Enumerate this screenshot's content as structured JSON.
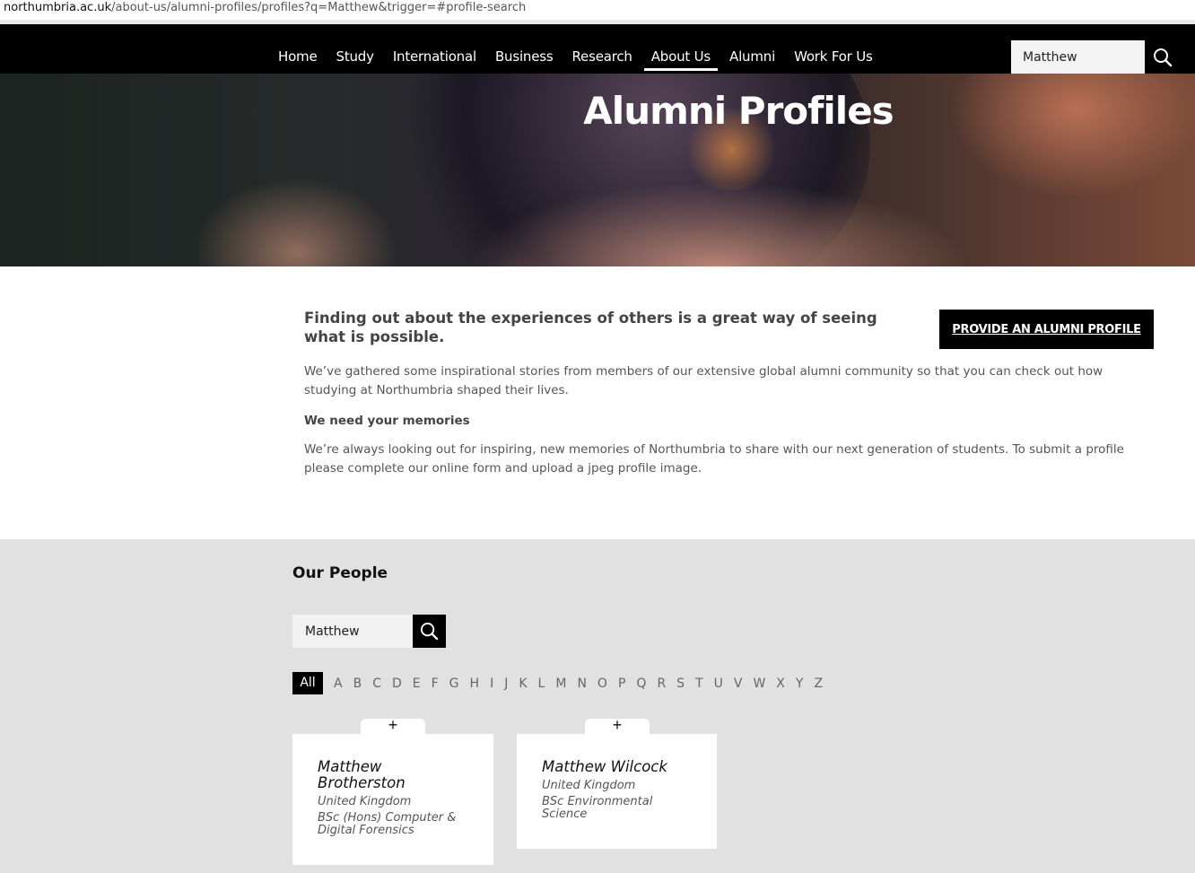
{
  "url": {
    "host": "northumbria.ac.uk",
    "path": "/about-us/alumni-profiles/profiles?q=Matthew&trigger=#profile-search"
  },
  "nav": {
    "items": [
      {
        "label": "Home"
      },
      {
        "label": "Study"
      },
      {
        "label": "International"
      },
      {
        "label": "Business"
      },
      {
        "label": "Research"
      },
      {
        "label": "About Us",
        "active": true
      },
      {
        "label": "Alumni"
      },
      {
        "label": "Work For Us"
      }
    ],
    "search_value": "Matthew",
    "search_icon": "search-icon"
  },
  "hero": {
    "title": "Alumni Profiles"
  },
  "intro": {
    "heading": "Finding out about the experiences of others is a great way of seeing what is possible.",
    "provide_button": "PROVIDE AN ALUMNI PROFILE",
    "paragraph1": "We’ve gathered some inspirational stories from members of our extensive global alumni community so that you can check out how studying at Northumbria shaped their lives.",
    "subheading": "We need your memories",
    "paragraph2": "We’re always looking out for inspiring, new memories of Northumbria to share with our next generation of students. To submit a profile please complete our online form and upload a jpeg profile image."
  },
  "people": {
    "title": "Our People",
    "search_value": "Matthew",
    "alpha_all": "All",
    "letters": [
      "A",
      "B",
      "C",
      "D",
      "E",
      "F",
      "G",
      "H",
      "I",
      "J",
      "K",
      "L",
      "M",
      "N",
      "O",
      "P",
      "Q",
      "R",
      "S",
      "T",
      "U",
      "V",
      "W",
      "X",
      "Y",
      "Z"
    ],
    "cards": [
      {
        "tab": "+",
        "name": "Matthew Brotherston",
        "location": "United Kingdom",
        "course": "BSc (Hons) Computer & Digital Forensics"
      },
      {
        "tab": "+",
        "name": "Matthew Wilcock",
        "location": "United Kingdom",
        "course": "BSc Environmental Science"
      }
    ]
  },
  "colors": {
    "nav_bg": "#000000",
    "section_bg": "#e1e1e1",
    "button_bg": "#000000"
  }
}
